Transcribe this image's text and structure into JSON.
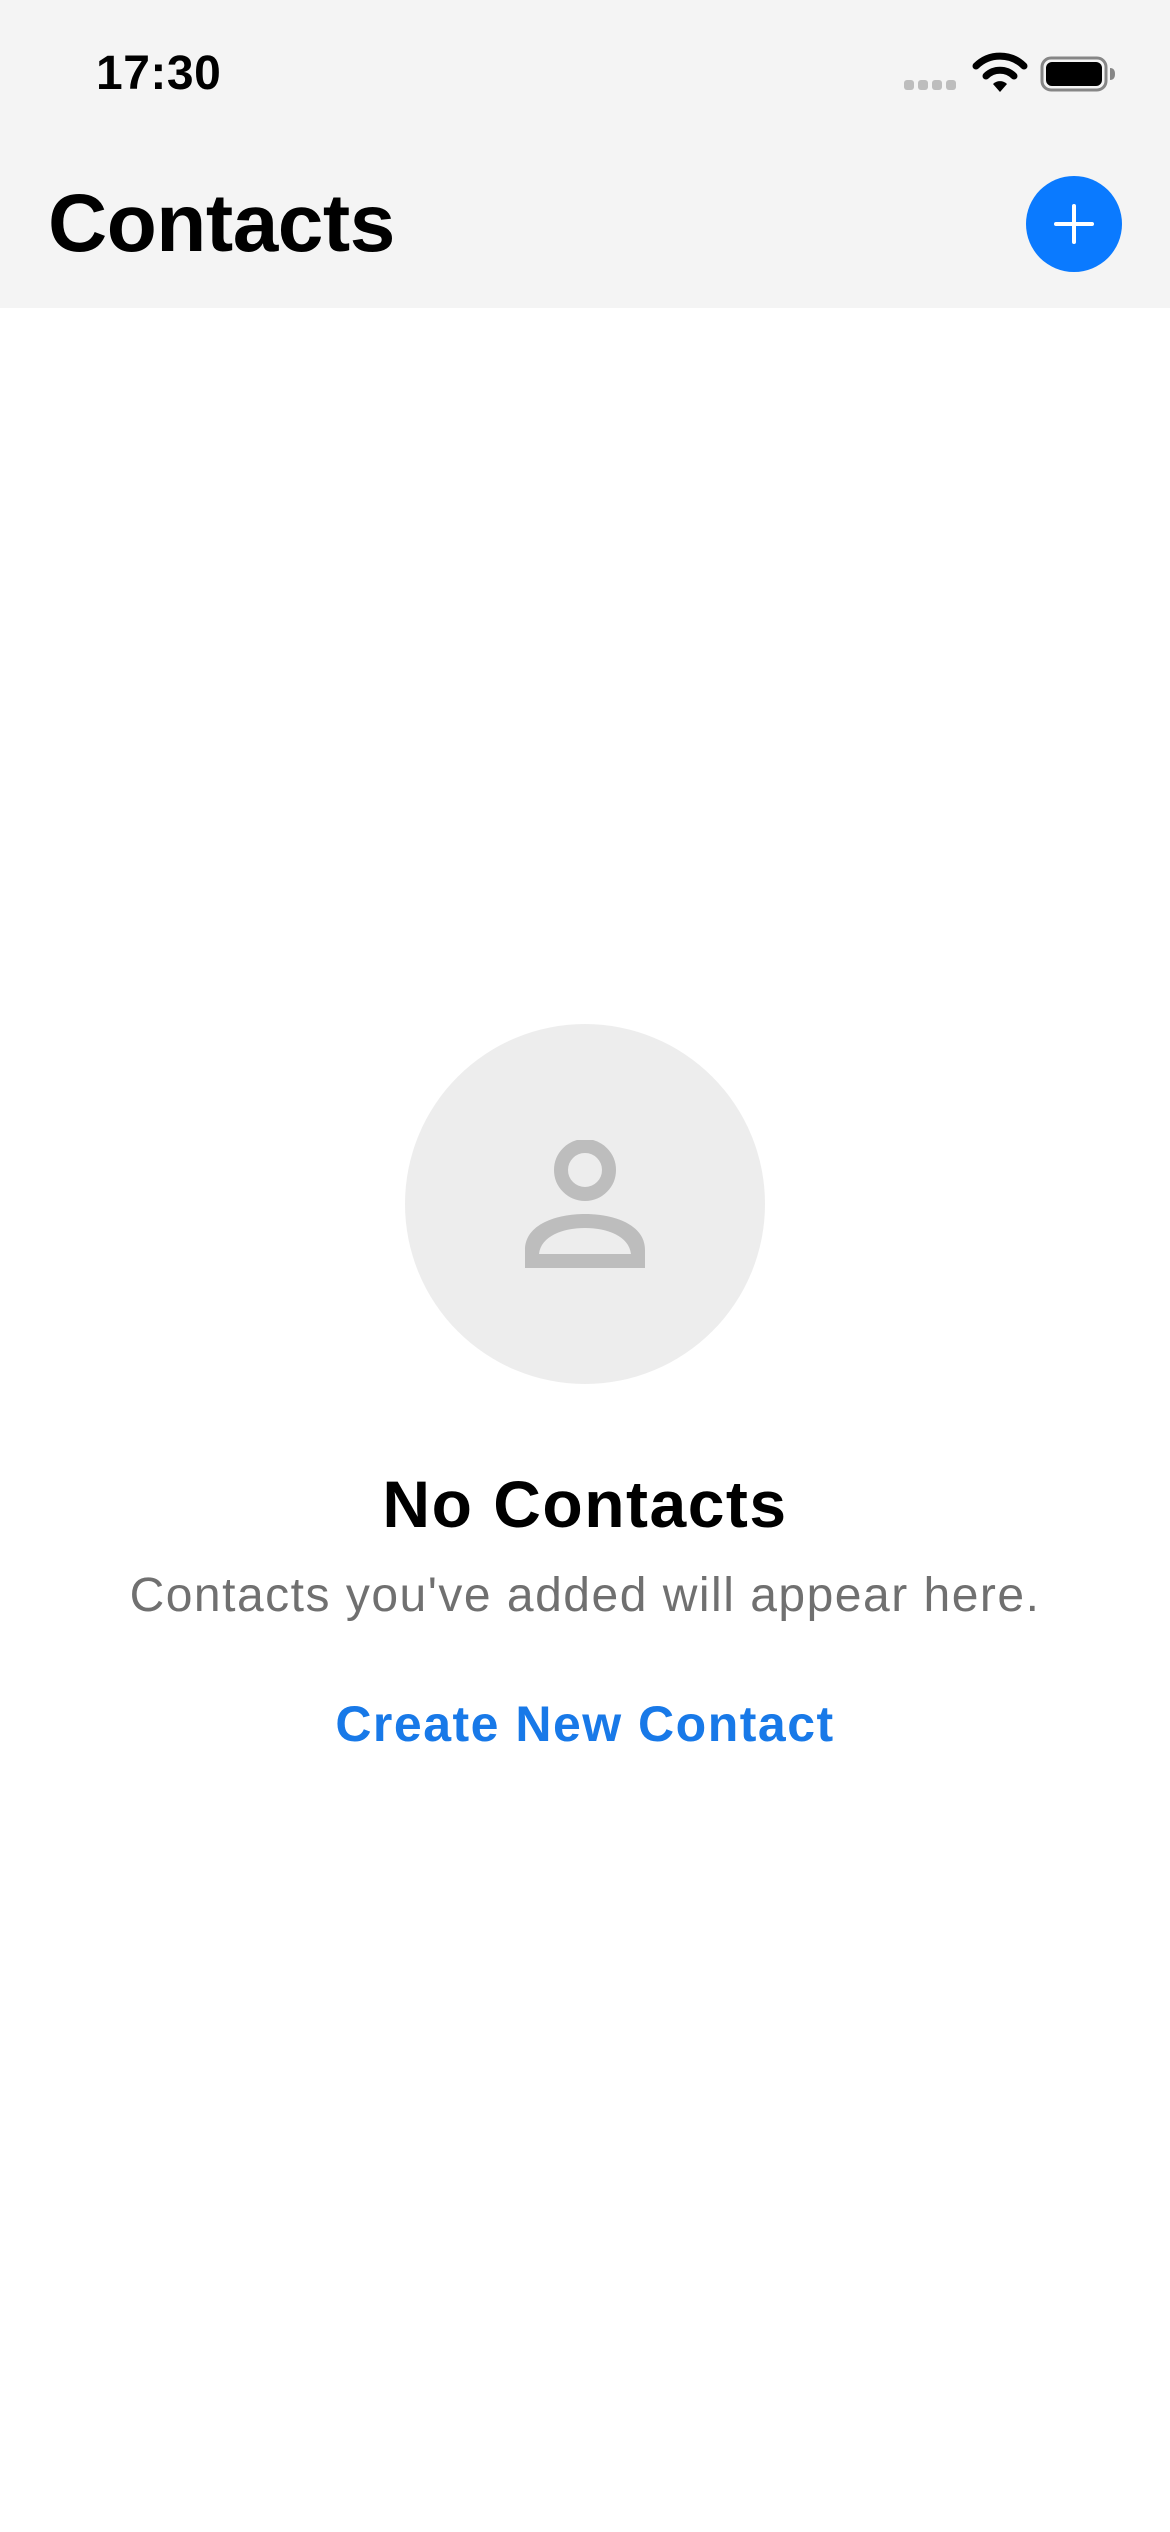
{
  "status_bar": {
    "time": "17:30",
    "signal_icon": "cellular-signal-icon",
    "wifi_icon": "wifi-icon",
    "battery_icon": "battery-icon"
  },
  "nav": {
    "title": "Contacts",
    "add_button_icon": "plus-icon"
  },
  "empty_state": {
    "avatar_icon": "person-icon",
    "title": "No Contacts",
    "message": "Contacts you've added will appear here.",
    "action_label": "Create New Contact"
  },
  "colors": {
    "header_background": "#f4f4f4",
    "accent": "#0a7aff",
    "link": "#1879e8",
    "secondary_text": "#707070",
    "avatar_background": "#ededed",
    "avatar_icon": "#bdbdbd"
  }
}
